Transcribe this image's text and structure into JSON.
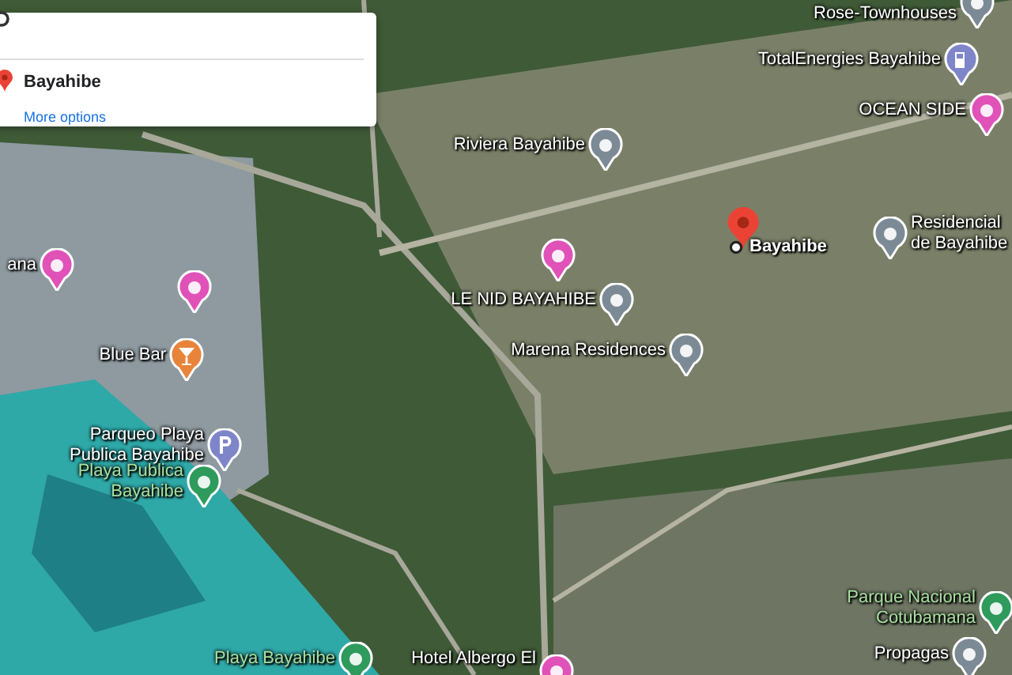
{
  "info_card": {
    "title": "Bayahibe",
    "link": "More options"
  },
  "selected_place": {
    "label": "Bayahibe"
  },
  "places": [
    {
      "kind": "pink",
      "label": "ana"
    },
    {
      "kind": "pink"
    },
    {
      "kind": "orange",
      "label": "Blue Bar"
    },
    {
      "kind": "gray",
      "label": "Riviera Bayahibe"
    },
    {
      "kind": "pink"
    },
    {
      "kind": "gray",
      "label": "LE NID BAYAHIBE"
    },
    {
      "kind": "gray",
      "label": "Marena Residences"
    },
    {
      "kind": "gray",
      "label": "Residencial\nde Bayahibe"
    },
    {
      "kind": "gray",
      "label": "Rose-Townhouses"
    },
    {
      "kind": "gas",
      "label": "TotalEnergies Bayahibe"
    },
    {
      "kind": "pink",
      "label": "OCEAN SIDE"
    },
    {
      "kind": "parking",
      "label": "Parqueo Playa\nPublica Bayahibe"
    },
    {
      "kind": "green",
      "label": "Playa Publica\nBayahibe"
    },
    {
      "kind": "green",
      "label": "Playa Bayahibe"
    },
    {
      "kind": "pink",
      "label": "Hotel Albergo El"
    },
    {
      "kind": "green",
      "label": "Parque Nacional\nCotubamana"
    },
    {
      "kind": "gray",
      "label": "Propagas"
    }
  ]
}
